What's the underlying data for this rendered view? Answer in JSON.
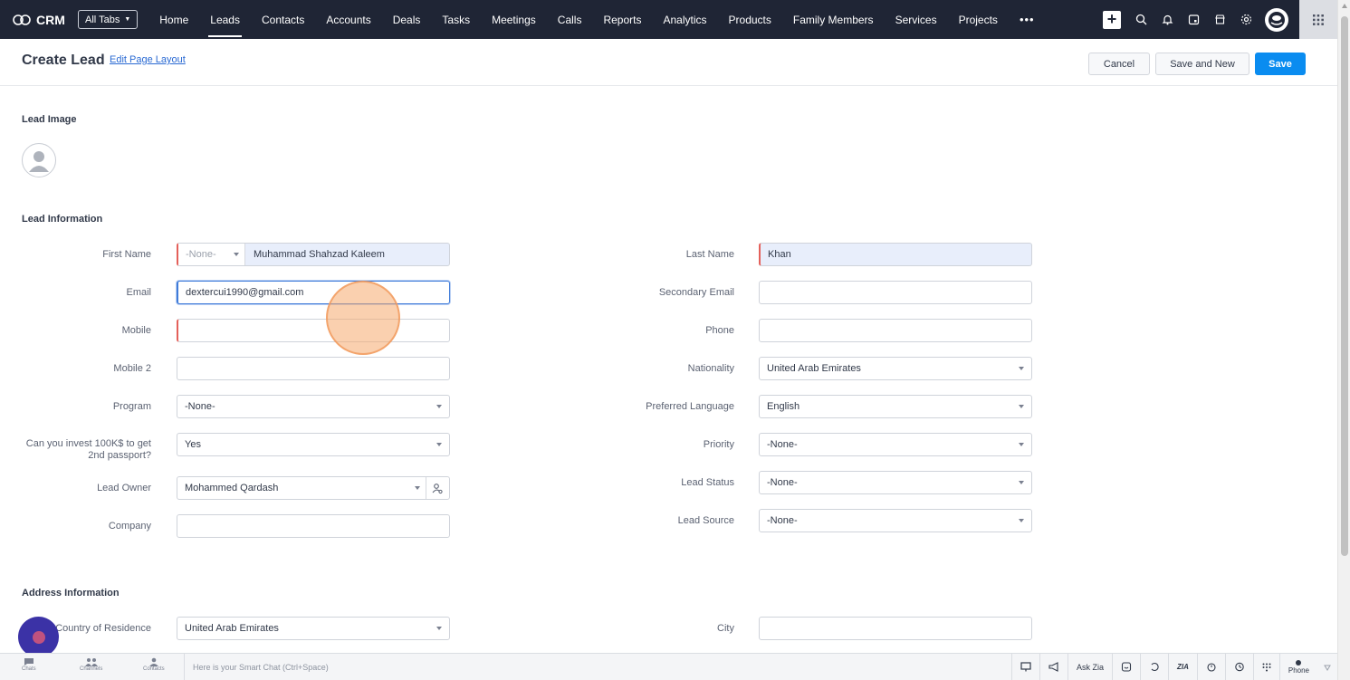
{
  "app": {
    "logo_text": "CRM",
    "all_tabs_label": "All Tabs"
  },
  "nav": {
    "items": [
      "Home",
      "Leads",
      "Contacts",
      "Accounts",
      "Deals",
      "Tasks",
      "Meetings",
      "Calls",
      "Reports",
      "Analytics",
      "Products",
      "Family Members",
      "Services",
      "Projects"
    ],
    "active": "Leads",
    "more": "•••"
  },
  "header": {
    "title": "Create Lead",
    "edit_layout": "Edit Page Layout",
    "cancel_label": "Cancel",
    "save_new_label": "Save and New",
    "save_label": "Save"
  },
  "sections": {
    "lead_image": "Lead Image",
    "lead_information": "Lead Information",
    "address_information": "Address Information"
  },
  "fields": {
    "first_name": {
      "label": "First Name",
      "salutation": "-None-",
      "value": "Muhammad Shahzad Kaleem"
    },
    "last_name": {
      "label": "Last Name",
      "value": "Khan"
    },
    "email": {
      "label": "Email",
      "value": "dextercui1990@gmail.com"
    },
    "secondary_email": {
      "label": "Secondary Email",
      "value": ""
    },
    "mobile": {
      "label": "Mobile",
      "value": ""
    },
    "phone": {
      "label": "Phone",
      "value": ""
    },
    "mobile2": {
      "label": "Mobile 2",
      "value": ""
    },
    "nationality": {
      "label": "Nationality",
      "value": "United Arab Emirates"
    },
    "program": {
      "label": "Program",
      "value": "-None-"
    },
    "preferred_language": {
      "label": "Preferred Language",
      "value": "English"
    },
    "invest": {
      "label_line1": "Can you invest 100K$ to get",
      "label_line2": "2nd passport?",
      "value": "Yes"
    },
    "priority": {
      "label": "Priority",
      "value": "-None-"
    },
    "lead_owner": {
      "label": "Lead Owner",
      "value": "Mohammed Qardash"
    },
    "lead_status": {
      "label": "Lead Status",
      "value": "-None-"
    },
    "company": {
      "label": "Company",
      "value": ""
    },
    "lead_source": {
      "label": "Lead Source",
      "value": "-None-"
    },
    "country_of_residence": {
      "label": "Country of Residence",
      "value": "United Arab Emirates"
    },
    "city": {
      "label": "City",
      "value": ""
    }
  },
  "bottombar": {
    "chats": "Chats",
    "channels": "Channels",
    "contacts": "Contacts",
    "smart_chat_placeholder": "Here is your Smart Chat (Ctrl+Space)",
    "ask_zia": "Ask Zia",
    "zia_icon_text": "ZIA",
    "phone": "Phone"
  },
  "colors": {
    "topbar": "#1f2535",
    "accent": "#0a8cf0",
    "mandatory": "#e4605a",
    "chat_bubble": "#3b32a6"
  }
}
